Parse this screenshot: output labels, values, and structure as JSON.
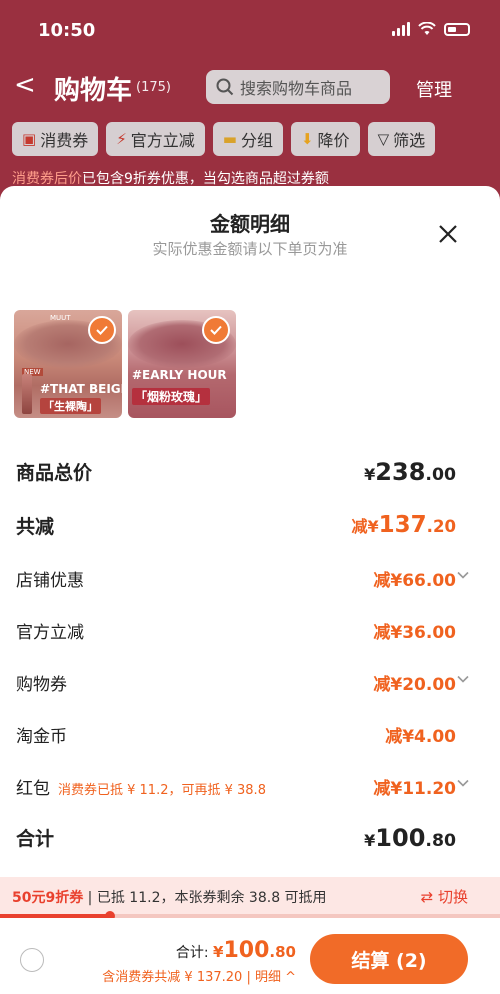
{
  "status": {
    "time": "10:50"
  },
  "nav": {
    "back": "<",
    "title": "购物车",
    "count": "(175)",
    "search_placeholder": "搜索购物车商品",
    "manage": "管理"
  },
  "filters": [
    {
      "label": "消费券"
    },
    {
      "label": "官方立减"
    },
    {
      "label": "分组"
    },
    {
      "label": "降价"
    },
    {
      "label": "筛选"
    }
  ],
  "dim_line": {
    "red_text": "消费券后价",
    "rest": "已包含9折券优惠，当勾选商品超过券额"
  },
  "sheet": {
    "title": "金额明细",
    "subtitle": "实际优惠金额请以下单页为准",
    "products": [
      {
        "brand": "MUUT",
        "tag": "NEW",
        "name": "#THAT BEIGE",
        "shade": "「生裸陶」"
      },
      {
        "name": "#EARLY HOUR",
        "shade": "「烟粉玫瑰」"
      }
    ],
    "rows": {
      "total_price": {
        "label": "商品总价",
        "yen": "¥",
        "int": "238",
        "dec": ".00"
      },
      "discount": {
        "label": "共减",
        "prefix": "减",
        "yen": "¥",
        "int": "137",
        "dec": ".20"
      },
      "store": {
        "label": "店铺优惠",
        "value": "减¥66.00"
      },
      "official": {
        "label": "官方立减",
        "value": "减¥36.00"
      },
      "shopping_coupon": {
        "label": "购物券",
        "value": "减¥20.00"
      },
      "taojinbi": {
        "label": "淘金币",
        "value": "减¥4.00"
      },
      "red_packet": {
        "label": "红包",
        "note": "消费券已抵 ¥ 11.2，可再抵 ¥ 38.8",
        "value": "减¥11.20"
      },
      "subtotal": {
        "label": "合计",
        "yen": "¥",
        "int": "100",
        "dec": ".80"
      }
    }
  },
  "promo": {
    "coupon": "50元9折券",
    "text": " | 已抵 11.2，本张券剩余 38.8 可抵用",
    "switch": "⇄ 切换",
    "progress": 0.22
  },
  "footer": {
    "total_label": "合计: ",
    "yen": "¥",
    "int": "100",
    "dec": ".80",
    "sub": "含消费券共减 ¥ 137.20 | 明细 ^",
    "checkout": "结算 (2)"
  },
  "colors": {
    "accent": "#f0621f",
    "checkout": "#f16b28",
    "coupon_red": "#e9412e",
    "header_bg": "#9a3040"
  }
}
